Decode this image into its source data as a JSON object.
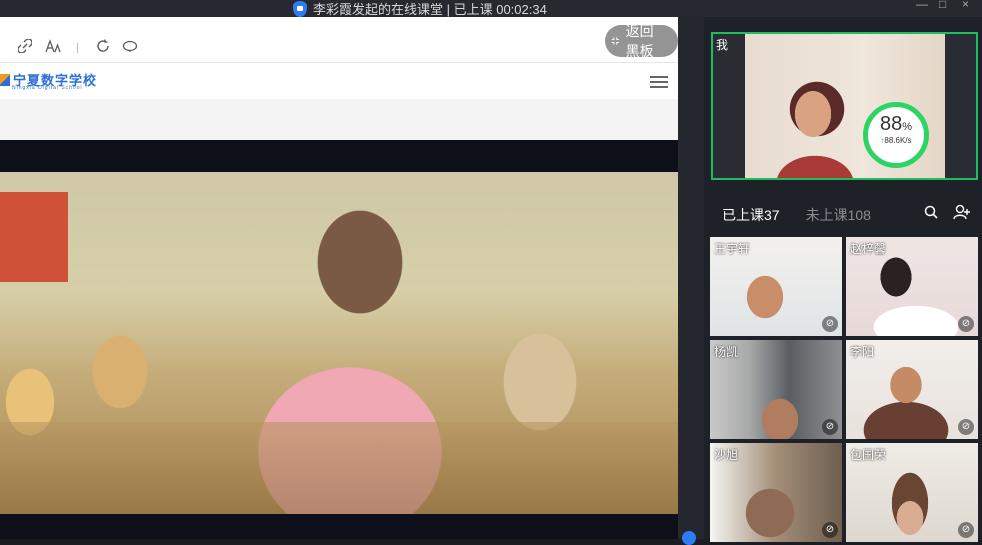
{
  "window": {
    "title": "李彩霞发起的在线课堂 | 已上课 00:02:34",
    "controls": [
      "—",
      "□",
      "×"
    ]
  },
  "browser_toolbar": {
    "icons": [
      "link-icon",
      "font-size-icon",
      "refresh-icon",
      "cloud-icon"
    ]
  },
  "site": {
    "logo_text": "宁夏数字学校",
    "logo_sub": "Ningxia Digital School"
  },
  "overlay": {
    "back_to_board": "返回黑板"
  },
  "self_view": {
    "label": "我",
    "network_percent": "88",
    "percent_sign": "%",
    "speed": "88.6K/s"
  },
  "tabs": {
    "attended": "已上课37",
    "not_attended": "未上课108"
  },
  "students": [
    {
      "name": "王宇轩"
    },
    {
      "name": "赵梓馨"
    },
    {
      "name": "杨凯"
    },
    {
      "name": "李阳"
    },
    {
      "name": "沙旭"
    },
    {
      "name": "包国荣"
    }
  ],
  "colors": {
    "accent_green": "#1fbd5b",
    "brand_blue": "#2a6fd6"
  }
}
